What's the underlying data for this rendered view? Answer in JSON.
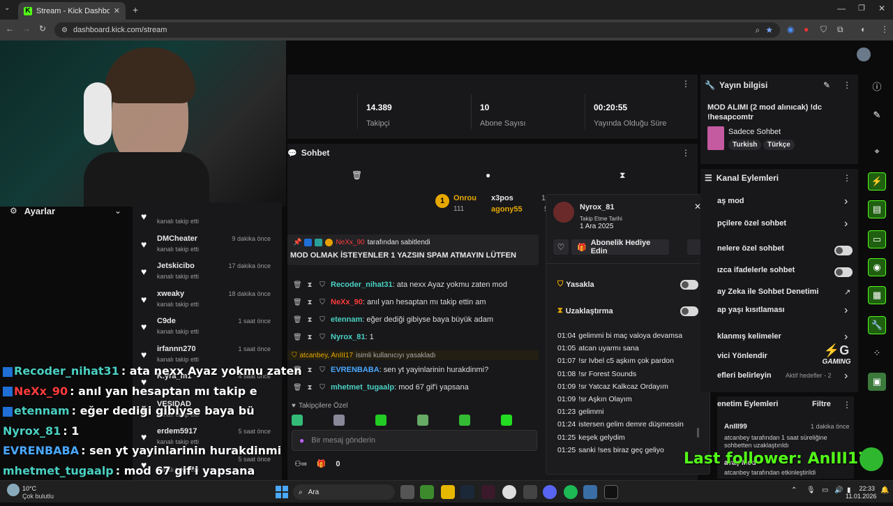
{
  "browser": {
    "tab_title": "Stream - Kick Dashboard",
    "url": "dashboard.kick.com/stream"
  },
  "stats": [
    {
      "value": "14.389",
      "label": "Takipçi"
    },
    {
      "value": "10",
      "label": "Abone Sayısı"
    },
    {
      "value": "00:20:55",
      "label": "Yayında Olduğu Süre"
    }
  ],
  "settings": {
    "label": "Ayarlar"
  },
  "followers": [
    {
      "name": "",
      "sub": "kanalı takip etti",
      "time": ""
    },
    {
      "name": "DMCheater",
      "sub": "kanalı takip etti",
      "time": "9 dakika önce"
    },
    {
      "name": "Jetskicibo",
      "sub": "kanalı takip etti",
      "time": "17 dakika önce"
    },
    {
      "name": "xweaky",
      "sub": "kanalı takip etti",
      "time": "18 dakika önce"
    },
    {
      "name": "C9de",
      "sub": "kanalı takip etti",
      "time": "1 saat önce"
    },
    {
      "name": "irfannn270",
      "sub": "kanalı takip etti",
      "time": "1 saat önce"
    },
    {
      "name": "K.yra_m1",
      "sub": "",
      "time": "4 saat önce"
    },
    {
      "name": "VESIDAD",
      "sub": "kanalı takip etti",
      "time": ""
    },
    {
      "name": "erdem5917",
      "sub": "kanalı takip etti",
      "time": "5 saat önce"
    },
    {
      "name": "",
      "sub": "kanalı takip etti",
      "time": "5 saat önce"
    },
    {
      "name": "",
      "sub": "kanalı takip etti",
      "time": "5 saat önce"
    }
  ],
  "chat": {
    "title": "Sohbet",
    "leaderboard": [
      {
        "name": "Onrou",
        "value": "111"
      },
      {
        "name": "x3pos",
        "value": "105"
      },
      {
        "name": "agony55",
        "value": "58"
      }
    ],
    "pinned_by": "NeXx_90",
    "pinned_suffix": "tarafından sabitlendi",
    "pinned_message": "MOD OLMAK İSTEYENLER 1 YAZSIN SPAM ATMAYIN LÜTFEN",
    "messages": [
      {
        "user": "Recoder_nihat31",
        "text": ": ata nexx Ayaz yokmu zaten mod",
        "color": "#4ad0c2"
      },
      {
        "user": "NeXx_90",
        "text": ": anıl yan hesaptan mı takip ettin am",
        "color": "#ff3b3b"
      },
      {
        "user": "etennam",
        "text": ": eğer dediği gibiyse baya büyük adam",
        "color": "#4ad0c2"
      },
      {
        "user": "Nyrox_81",
        "text": ": 1",
        "color": "#4ad0c2"
      },
      {
        "user": "EVRENBABA",
        "text": ": sen yt yayinlarinin hurakdinmi?",
        "color": "#4aa8ff"
      },
      {
        "user": "mhetmet_tugaalp",
        "text": ": mod 67 gif'i yapsana",
        "color": "#4ad0c2"
      }
    ],
    "ban_notice_users": "atcanbey, AnIII17",
    "ban_notice_text": "isimli kullanıcıyı yasakladı",
    "followers_only": "Takipçilere Özel",
    "input_placeholder": "Bir mesaj gönderin",
    "footer_count": "0"
  },
  "user_card": {
    "name": "Nyrox_81",
    "follow_label": "Takip Etme Tarihi",
    "follow_date": "1 Ara 2025",
    "gift_button": "Abonelik Hediye Edin",
    "ban_label": "Yasakla",
    "timeout_label": "Uzaklaştırma",
    "history": [
      {
        "time": "01:04",
        "text": "gelimmi bi maç valoya devamsa"
      },
      {
        "time": "01:05",
        "text": "atcan uyarmı sana"
      },
      {
        "time": "01:07",
        "text": "!sr Ivbel c5 aşkım çok pardon"
      },
      {
        "time": "01:08",
        "text": "!sr Forest Sounds"
      },
      {
        "time": "01:09",
        "text": "!sr Yatcaz Kalkcaz Ordayım"
      },
      {
        "time": "01:09",
        "text": "!sr Aşkın Olayım"
      },
      {
        "time": "01:23",
        "text": "gelimmi"
      },
      {
        "time": "01:24",
        "text": "istersen gelim demre düşmessin"
      },
      {
        "time": "01:25",
        "text": "keşek gelydim"
      },
      {
        "time": "01:25",
        "text": "sanki !ses biraz geç geliyo"
      }
    ]
  },
  "stream_info": {
    "title": "Yayın bilgisi",
    "stream_title": "MOD ALIMI (2 mod alınıcak) !dc !hesapcomtr",
    "category": "Sadece Sohbet",
    "tags": [
      "Turkish",
      "Türkçe"
    ]
  },
  "channel_actions": {
    "title": "Kanal Eylemleri",
    "items": [
      {
        "label": "aş mod",
        "control": "chevron"
      },
      {
        "label": "pçilere özel sohbet",
        "control": "chevron"
      },
      {
        "label": "nelere özel sohbet",
        "control": "toggle"
      },
      {
        "label": "ızca ifadelerle sohbet",
        "control": "toggle"
      },
      {
        "label": "ay Zeka ile Sohbet Denetimi",
        "control": "external"
      },
      {
        "label": "ap yaşı kısıtlaması",
        "control": "chevron"
      },
      {
        "label": "klanmış kelimeler",
        "control": "chevron"
      },
      {
        "label": "vici Yönlendir",
        "control": "none"
      },
      {
        "label": "efleri belirleyin",
        "control": "chevron",
        "extra": "Aktif hedefler - 2"
      }
    ]
  },
  "mod_actions": {
    "title": "enetim Eylemleri",
    "filter": "Filtre",
    "entries": [
      {
        "user": "AnIII99",
        "time": "1 dakika önce",
        "text": "atcanbey tarafından 1 saat süreliğine sohbetten uzaklaştırıldı"
      },
      {
        "user": "avaş Mod",
        "time": "",
        "text": "atcanbey tarafından etkinleştirildi"
      }
    ]
  },
  "overlay": {
    "chat_lines": [
      {
        "user": "Recoder_nihat31",
        "text": ": ata nexx Ayaz yokmu zaten",
        "color": "#4ad0c2"
      },
      {
        "user": "NeXx_90",
        "text": ": anıl yan hesaptan mı takip e",
        "color": "#ff3b3b"
      },
      {
        "user": "etennam",
        "text": ": eğer dediği gibiyse baya bü",
        "color": "#4ad0c2"
      },
      {
        "user": "Nyrox_81",
        "text": ": 1",
        "color": "#4ad0c2"
      },
      {
        "user": "EVRENBABA",
        "text": ": sen yt yayinlarinin hurakdinmi",
        "color": "#4aa8ff"
      },
      {
        "user": "mhetmet_tugaalp",
        "text": ": mod 67 gif'i yapsana",
        "color": "#4ad0c2"
      }
    ],
    "last_follower": "Last follower: AnIII17",
    "logo_text": "GAMING"
  },
  "taskbar": {
    "weather_temp": "10°C",
    "weather_desc": "Çok bulutlu",
    "search_label": "Ara",
    "time": "22:33",
    "date": "11.01.2026"
  }
}
